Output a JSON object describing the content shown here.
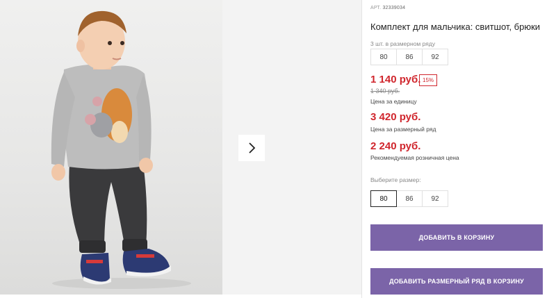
{
  "product": {
    "art_label": "АРТ.",
    "art_number": "32339034",
    "title": "Комплект для мальчика: свитшот, брюки",
    "series_note": "3 шт. в размерном ряду",
    "series_sizes": [
      "80",
      "86",
      "92"
    ]
  },
  "pricing": {
    "unit_price": "1 140 руб.",
    "discount_badge": "15%",
    "old_price": "1 340 руб.",
    "unit_caption": "Цена за единицу",
    "series_price": "3 420 руб.",
    "series_caption": "Цена за размерный ряд",
    "retail_price": "2 240 руб.",
    "retail_caption": "Рекомендуемая розничная цена"
  },
  "size_picker": {
    "label": "Выберите размер:",
    "options": [
      "80",
      "86",
      "92"
    ],
    "selected": "80"
  },
  "actions": {
    "add_to_cart": "ДОБАВИТЬ В КОРЗИНУ",
    "add_series_to_cart": "ДОБАВИТЬ РАЗМЕРНЫЙ РЯД В КОРЗИНУ"
  },
  "colors": {
    "price_red": "#d0262d",
    "button_purple": "#7b64a8"
  },
  "icons": {
    "gallery_next": "chevron-right-icon"
  }
}
